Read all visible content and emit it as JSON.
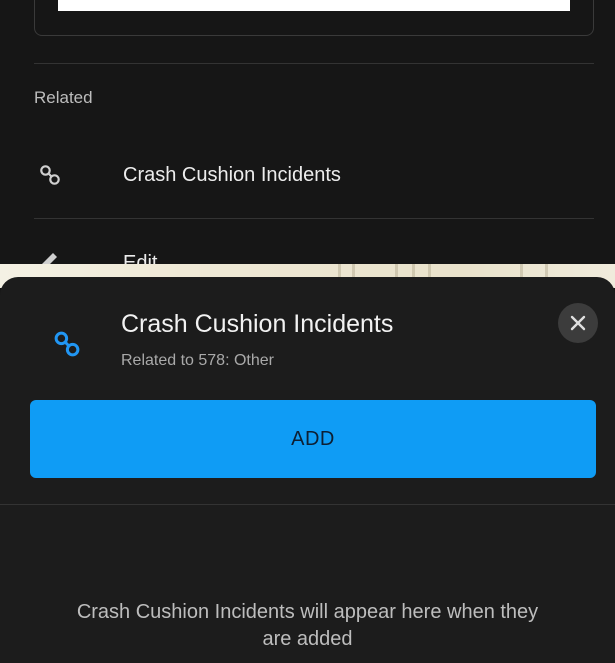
{
  "background": {
    "related_label": "Related",
    "rows": [
      {
        "icon": "link-icon",
        "label": "Crash Cushion Incidents"
      },
      {
        "icon": "pencil-icon",
        "label": "Edit"
      }
    ]
  },
  "sheet": {
    "icon": "link-icon",
    "title": "Crash Cushion Incidents",
    "subtitle": "Related to 578: Other",
    "close_icon": "close-icon",
    "add_label": "ADD",
    "empty_message": "Crash Cushion Incidents will appear here when they are added"
  },
  "colors": {
    "accent": "#0f9cf5",
    "link_icon": "#2196f3",
    "background": "#161616",
    "sheet": "#1c1c1c"
  }
}
